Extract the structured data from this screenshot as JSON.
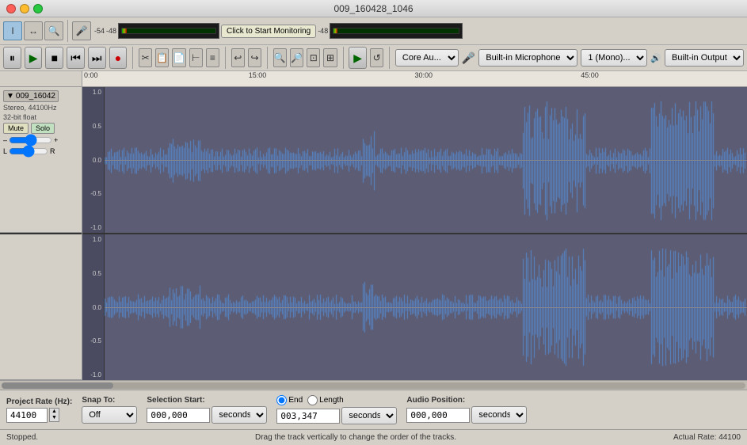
{
  "window": {
    "title": "009_160428_1046"
  },
  "toolbar": {
    "tools": [
      "I-beam",
      "Move",
      "Zoom"
    ],
    "monitor_btn": "Click to Start Monitoring",
    "transport": {
      "pause": "⏸",
      "play": "▶",
      "stop": "■",
      "prev": "⏮",
      "next": "⏭",
      "record": "●"
    }
  },
  "devices": {
    "playback_label": "Core Au...",
    "mic_label": "Built-in Microphone",
    "channel_label": "1 (Mono)...",
    "output_label": "Built-in Output"
  },
  "track": {
    "name": "009_16042",
    "format": "Stereo, 44100Hz",
    "bit_depth": "32-bit float",
    "mute": "Mute",
    "solo": "Solo"
  },
  "ruler": {
    "marks": [
      "0:00",
      "15:00",
      "30:00",
      "45:00"
    ]
  },
  "waveform": {
    "scale_top1": "1.0",
    "scale_mid_pos1": "0.5",
    "scale_zero1": "0.0",
    "scale_mid_neg1": "-0.5",
    "scale_bot1": "-1.0",
    "scale_top2": "1.0",
    "scale_mid_pos2": "0.5",
    "scale_zero2": "0.0",
    "scale_mid_neg2": "-0.5",
    "scale_bot2": "-1.0"
  },
  "bottom": {
    "project_rate_label": "Project Rate (Hz):",
    "project_rate_value": "44100",
    "snap_label": "Snap To:",
    "snap_value": "Off",
    "selection_start_label": "Selection Start:",
    "selection_start_value": "000,000",
    "selection_start_unit": "seconds",
    "end_label": "End",
    "length_label": "Length",
    "end_value": "003,347",
    "end_unit": "seconds",
    "audio_pos_label": "Audio Position:",
    "audio_pos_value": "000,000",
    "audio_pos_unit": "seconds"
  },
  "status": {
    "left": "Stopped.",
    "hint": "Drag the track vertically to change the order of the tracks.",
    "right": "Actual Rate: 44100"
  },
  "colors": {
    "waveform_fill": "#6688cc",
    "waveform_bg": "#5c5c74",
    "track_bg": "#5a5a72"
  }
}
